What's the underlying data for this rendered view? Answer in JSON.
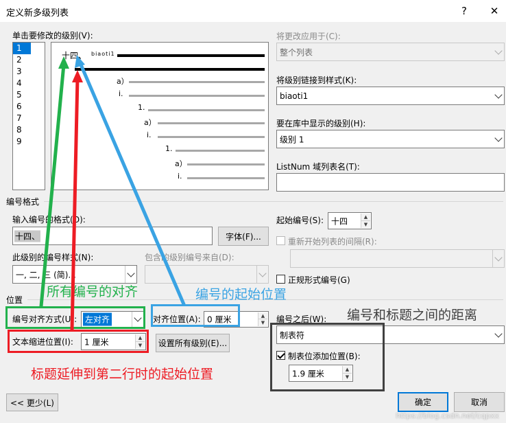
{
  "window": {
    "title": "定义新多级列表",
    "help_glyph": "?",
    "close_glyph": "✕"
  },
  "level_section": {
    "label": "单击要修改的级别(V):",
    "levels": [
      "1",
      "2",
      "3",
      "4",
      "5",
      "6",
      "7",
      "8",
      "9"
    ],
    "selected": "1"
  },
  "preview": {
    "first_number": "十四、",
    "first_text": "biaoti1",
    "sub_numbers": [
      "a）",
      "i.",
      "1.",
      "a）",
      "i.",
      "1.",
      "a）",
      "i."
    ]
  },
  "right_panel": {
    "apply_label": "将更改应用于(C):",
    "apply_value": "整个列表",
    "link_label": "将级别链接到样式(K):",
    "link_value": "biaoti1",
    "gallery_label": "要在库中显示的级别(H):",
    "gallery_value": "级别 1",
    "listnum_label": "ListNum 域列表名(T):",
    "listnum_value": ""
  },
  "number_format": {
    "section_label": "编号格式",
    "format_label": "输入编号的格式(O):",
    "format_value": "十四、",
    "font_button": "字体(F)...",
    "style_label": "此级别的编号样式(N):",
    "style_value": "一, 二, 三 (简)...",
    "include_label": "包含的级别编号来自(D):",
    "start_label": "起始编号(S):",
    "start_value": "十四",
    "restart_label": "重新开始列表的间隔(R):",
    "legal_label": "正规形式编号(G)"
  },
  "position": {
    "section_label": "位置",
    "align_label": "编号对齐方式(U):",
    "align_value": "左对齐",
    "align_at_label": "对齐位置(A):",
    "align_at_value": "0 厘米",
    "indent_label": "文本缩进位置(I):",
    "indent_value": "1 厘米",
    "set_all_button": "设置所有级别(E)...",
    "follow_label": "编号之后(W):",
    "follow_value": "制表符",
    "tab_stop_label": "制表位添加位置(B):",
    "tab_stop_checked": true,
    "tab_stop_value": "1.9 厘米"
  },
  "footer": {
    "less_button": "<< 更少(L)",
    "ok_button": "确定",
    "cancel_button": "取消"
  },
  "annotations": {
    "align_note": "所有编号的对齐",
    "start_note": "编号的起始位置",
    "distance_note": "编号和标题之间的距离",
    "indent_note": "标题延伸到第二行时的起始位置",
    "colors": {
      "green": "#22b14c",
      "blue": "#3aa3e3",
      "red": "#ed1c24",
      "dark": "#404040"
    }
  },
  "watermark": "https://blog.csdn.net/cqpxx"
}
